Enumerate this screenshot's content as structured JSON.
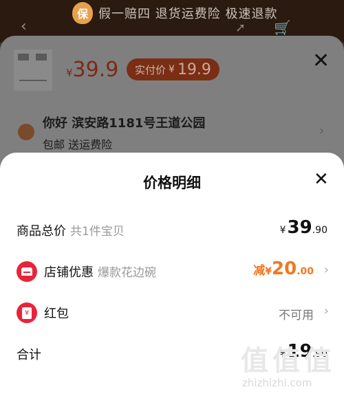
{
  "banner": {
    "badge": "保",
    "text": "假一赔四 退货运费险 极速退款"
  },
  "sku_sheet": {
    "price_yen": "¥",
    "price": "39.9",
    "real_price_label": "实付价",
    "real_price_yen": "¥",
    "real_price": "19.9",
    "address_title": "你好 滨安路1181号王道公园",
    "address_sub": "包邮 送运费险"
  },
  "detail": {
    "title": "价格明细",
    "rows": [
      {
        "label": "商品总价",
        "sub": "共1件宝贝",
        "yen": "¥",
        "int": "39",
        "dec": ".90"
      },
      {
        "label": "店铺优惠",
        "sub": "爆款花边碗",
        "prefix": "减",
        "yen": "¥",
        "int": "20",
        "dec": ".00"
      },
      {
        "label": "红包",
        "value": "不可用"
      },
      {
        "label": "合计",
        "yen": "¥",
        "int": "19",
        "dec": ".90"
      }
    ]
  },
  "watermark": {
    "glyphs": [
      "值",
      "值",
      "值"
    ],
    "text": "zhizhizhi.com"
  },
  "icons": {
    "back": "chevron-left-icon",
    "share": "share-icon",
    "cart": "cart-icon",
    "close": "close-icon",
    "location": "location-pin-icon",
    "store": "store-icon",
    "red_packet": "red-packet-icon",
    "chevron": "chevron-right-icon"
  },
  "colors": {
    "discount": "#f07820",
    "icon_red": "#e8243a"
  }
}
